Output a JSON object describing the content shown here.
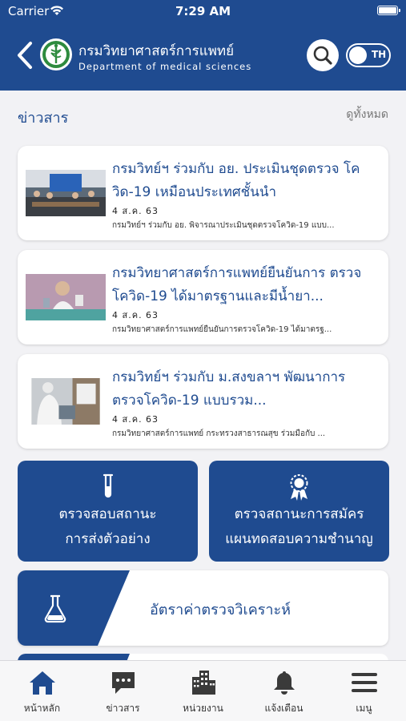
{
  "status_bar": {
    "carrier": "Carrier",
    "time": "7:29 AM"
  },
  "header": {
    "title_th": "กรมวิทยาศาสตร์การแพทย์",
    "title_en": "Department of medical sciences",
    "language": "TH"
  },
  "news": {
    "section_title": "ข่าวสาร",
    "see_all": "ดูทั้งหมด",
    "items": [
      {
        "title": "กรมวิทย์ฯ ร่วมกับ อย. ประเมินชุดตรวจ โควิด-19 เหมือนประเทศชั้นนำ",
        "date": "4 ส.ค. 63",
        "summary": "กรมวิทย์ฯ ร่วมกับ อย. พิจารณาประเมินชุดตรวจโควิด-19 แบบ..."
      },
      {
        "title": "กรมวิทยาศาสตร์การแพทย์ยืนยันการ ตรวจโควิด-19 ได้มาตรฐานและมีน้ำยา...",
        "date": "4 ส.ค. 63",
        "summary": "กรมวิทยาศาสตร์การแพทย์ยืนยันการตรวจโควิด-19 ได้มาตรฐ..."
      },
      {
        "title": "กรมวิทย์ฯ ร่วมกับ ม.สงขลาฯ พัฒนาการตรวจโควิด-19 แบบรวม...",
        "date": "4 ส.ค. 63",
        "summary": "กรมวิทยาศาสตร์การแพทย์ กระทรวงสาธารณสุข ร่วมมือกับ ..."
      }
    ]
  },
  "services": {
    "sample_status": {
      "line1": "ตรวจสอบสถานะ",
      "line2": "การส่งตัวอย่าง",
      "icon": "test-tube-icon"
    },
    "proficiency": {
      "line1": "ตรวจสถานะการสมัคร",
      "line2": "แผนทดสอบความชำนาญ",
      "icon": "award-icon"
    },
    "rates": {
      "label": "อัตราค่าตรวจวิเคราะห์",
      "icon": "flask-icon"
    }
  },
  "tabbar": {
    "items": [
      {
        "label": "หน้าหลัก",
        "icon": "home-icon",
        "active": true
      },
      {
        "label": "ข่าวสาร",
        "icon": "chat-icon",
        "active": false
      },
      {
        "label": "หน่วยงาน",
        "icon": "building-icon",
        "active": false
      },
      {
        "label": "แจ้งเตือน",
        "icon": "bell-icon",
        "active": false
      },
      {
        "label": "เมนู",
        "icon": "menu-icon",
        "active": false
      }
    ]
  },
  "colors": {
    "primary": "#1f4b90",
    "background": "#f2f2f5",
    "card": "#ffffff"
  }
}
